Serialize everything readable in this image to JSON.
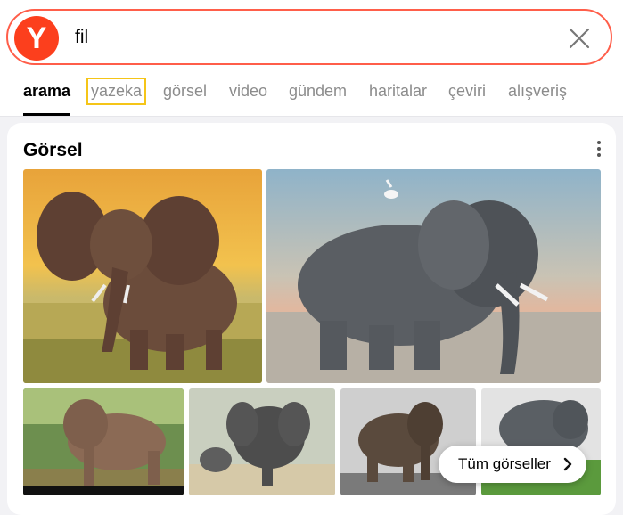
{
  "search": {
    "query": "fil",
    "logo_letter": "Y"
  },
  "tabs": [
    {
      "label": "arama",
      "active": true
    },
    {
      "label": "yazeka"
    },
    {
      "label": "görsel"
    },
    {
      "label": "video"
    },
    {
      "label": "gündem"
    },
    {
      "label": "haritalar"
    },
    {
      "label": "çeviri"
    },
    {
      "label": "alışveriş"
    }
  ],
  "images_section": {
    "title": "Görsel",
    "all_images_label": "Tüm görseller"
  },
  "colors": {
    "brand": "#fc3f1d",
    "search_border": "#ff5e4a",
    "highlight": "#f5c518"
  }
}
